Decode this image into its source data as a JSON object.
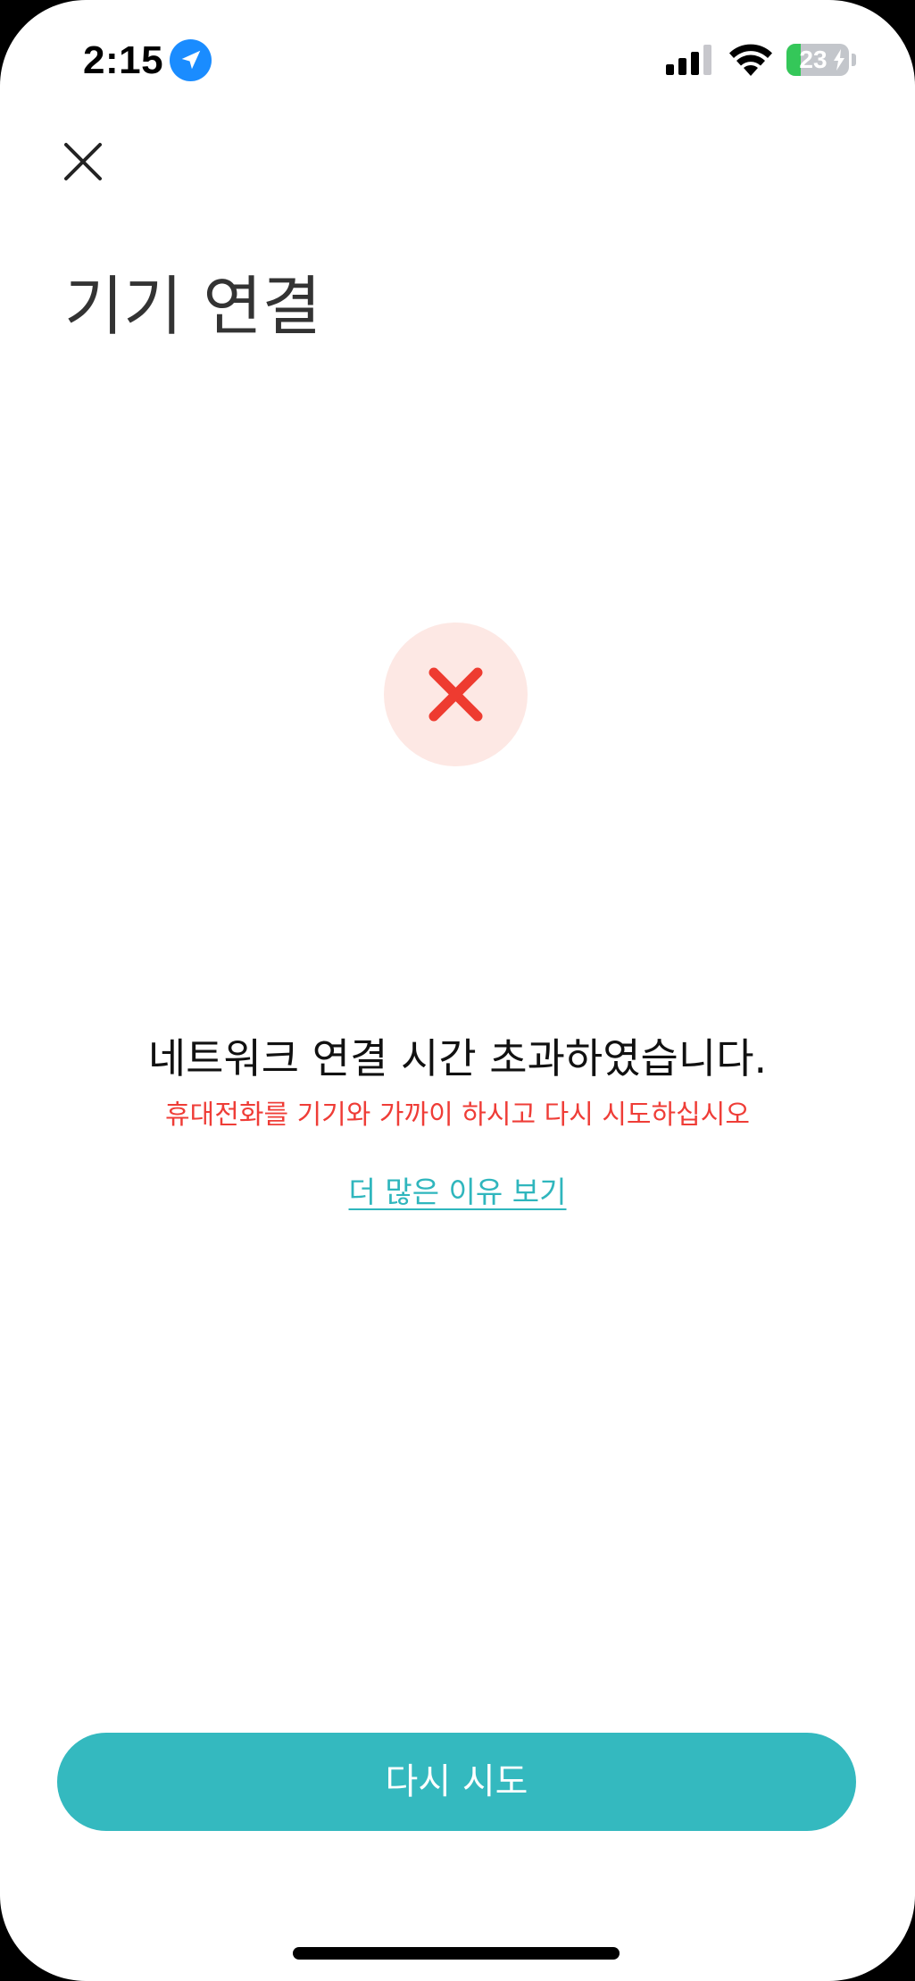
{
  "status_bar": {
    "time": "2:15",
    "battery_level": "23",
    "battery_fraction": 0.23,
    "signal_bars": 3,
    "icons": [
      "location-arrow-icon",
      "cellular-signal-icon",
      "wifi-icon",
      "battery-charging-icon"
    ]
  },
  "header": {
    "close_icon": "close-icon",
    "title": "기기 연결"
  },
  "error": {
    "icon": "error-x-icon",
    "title": "네트워크 연결 시간 초과하였습니다.",
    "subtitle": "휴대전화를 기기와 가까이 하시고 다시 시도하십시오",
    "more_link": "더 많은 이유 보기"
  },
  "footer": {
    "retry_label": "다시 시도"
  },
  "colors": {
    "accent": "#34b9bf",
    "link": "#2fb6bd",
    "error": "#ef3d37",
    "error_bg": "#fde8e4",
    "battery_green": "#34c759",
    "location_blue": "#1a8cff"
  }
}
